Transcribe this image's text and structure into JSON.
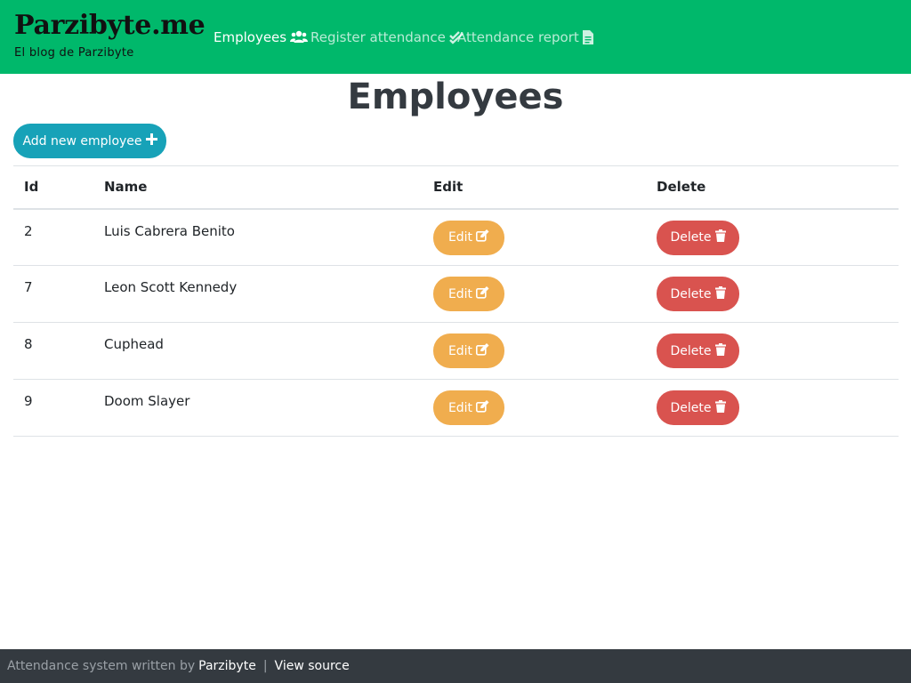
{
  "header": {
    "brand_title": "Parzibyte.me",
    "brand_subtitle": "El blog de Parzibyte",
    "nav": [
      {
        "label": "Employees",
        "icon": "users-icon",
        "active": true
      },
      {
        "label": "Register attendance",
        "icon": "double-check-icon",
        "active": false
      },
      {
        "label": "Attendance report",
        "icon": "file-icon",
        "active": false
      }
    ],
    "bg_color": "#00b86b"
  },
  "page": {
    "title": "Employees",
    "add_button_label": "Add new employee",
    "add_button_icon": "plus-icon"
  },
  "table": {
    "columns": [
      "Id",
      "Name",
      "Edit",
      "Delete"
    ],
    "edit_label": "Edit",
    "edit_icon": "edit-icon",
    "delete_label": "Delete",
    "delete_icon": "trash-icon",
    "rows": [
      {
        "id": "2",
        "name": "Luis Cabrera Benito"
      },
      {
        "id": "7",
        "name": "Leon Scott Kennedy"
      },
      {
        "id": "8",
        "name": "Cuphead"
      },
      {
        "id": "9",
        "name": "Doom Slayer"
      }
    ]
  },
  "footer": {
    "text": "Attendance system written by",
    "author_link": "Parzibyte",
    "separator": "|",
    "source_link": "View source"
  },
  "colors": {
    "accent": "#00b86b",
    "info": "#17a2b8",
    "warning": "#f0ad4e",
    "danger": "#d9534f",
    "footer_bg": "#343a40"
  }
}
